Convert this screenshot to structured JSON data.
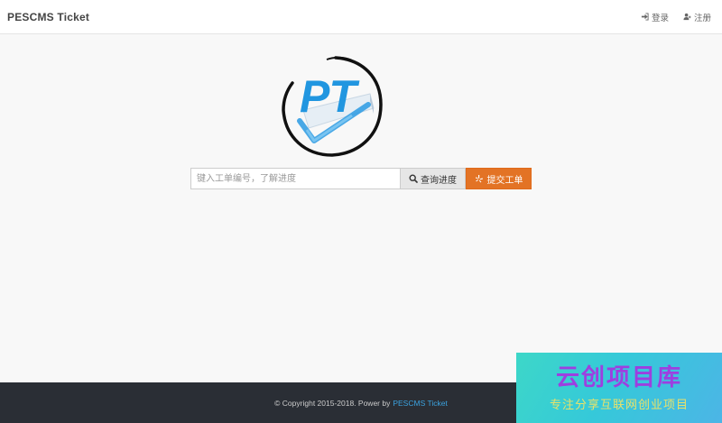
{
  "header": {
    "brand": "PESCMS Ticket",
    "login_label": "登录",
    "register_label": "注册"
  },
  "logo": {
    "text": "PT"
  },
  "search": {
    "placeholder": "键入工单编号，了解进度",
    "query_label": "查询进度",
    "submit_label": "提交工单"
  },
  "footer": {
    "copyright": "© Copyright 2015-2018. Power by",
    "link_text": "PESCMS Ticket"
  },
  "watermark": {
    "title": "云创项目库",
    "subtitle": "专注分享互联网创业项目"
  },
  "colors": {
    "accent_orange": "#e37325",
    "logo_blue": "#2196e0",
    "footer_bg": "#2a2e35",
    "link_blue": "#3ba3e0"
  }
}
